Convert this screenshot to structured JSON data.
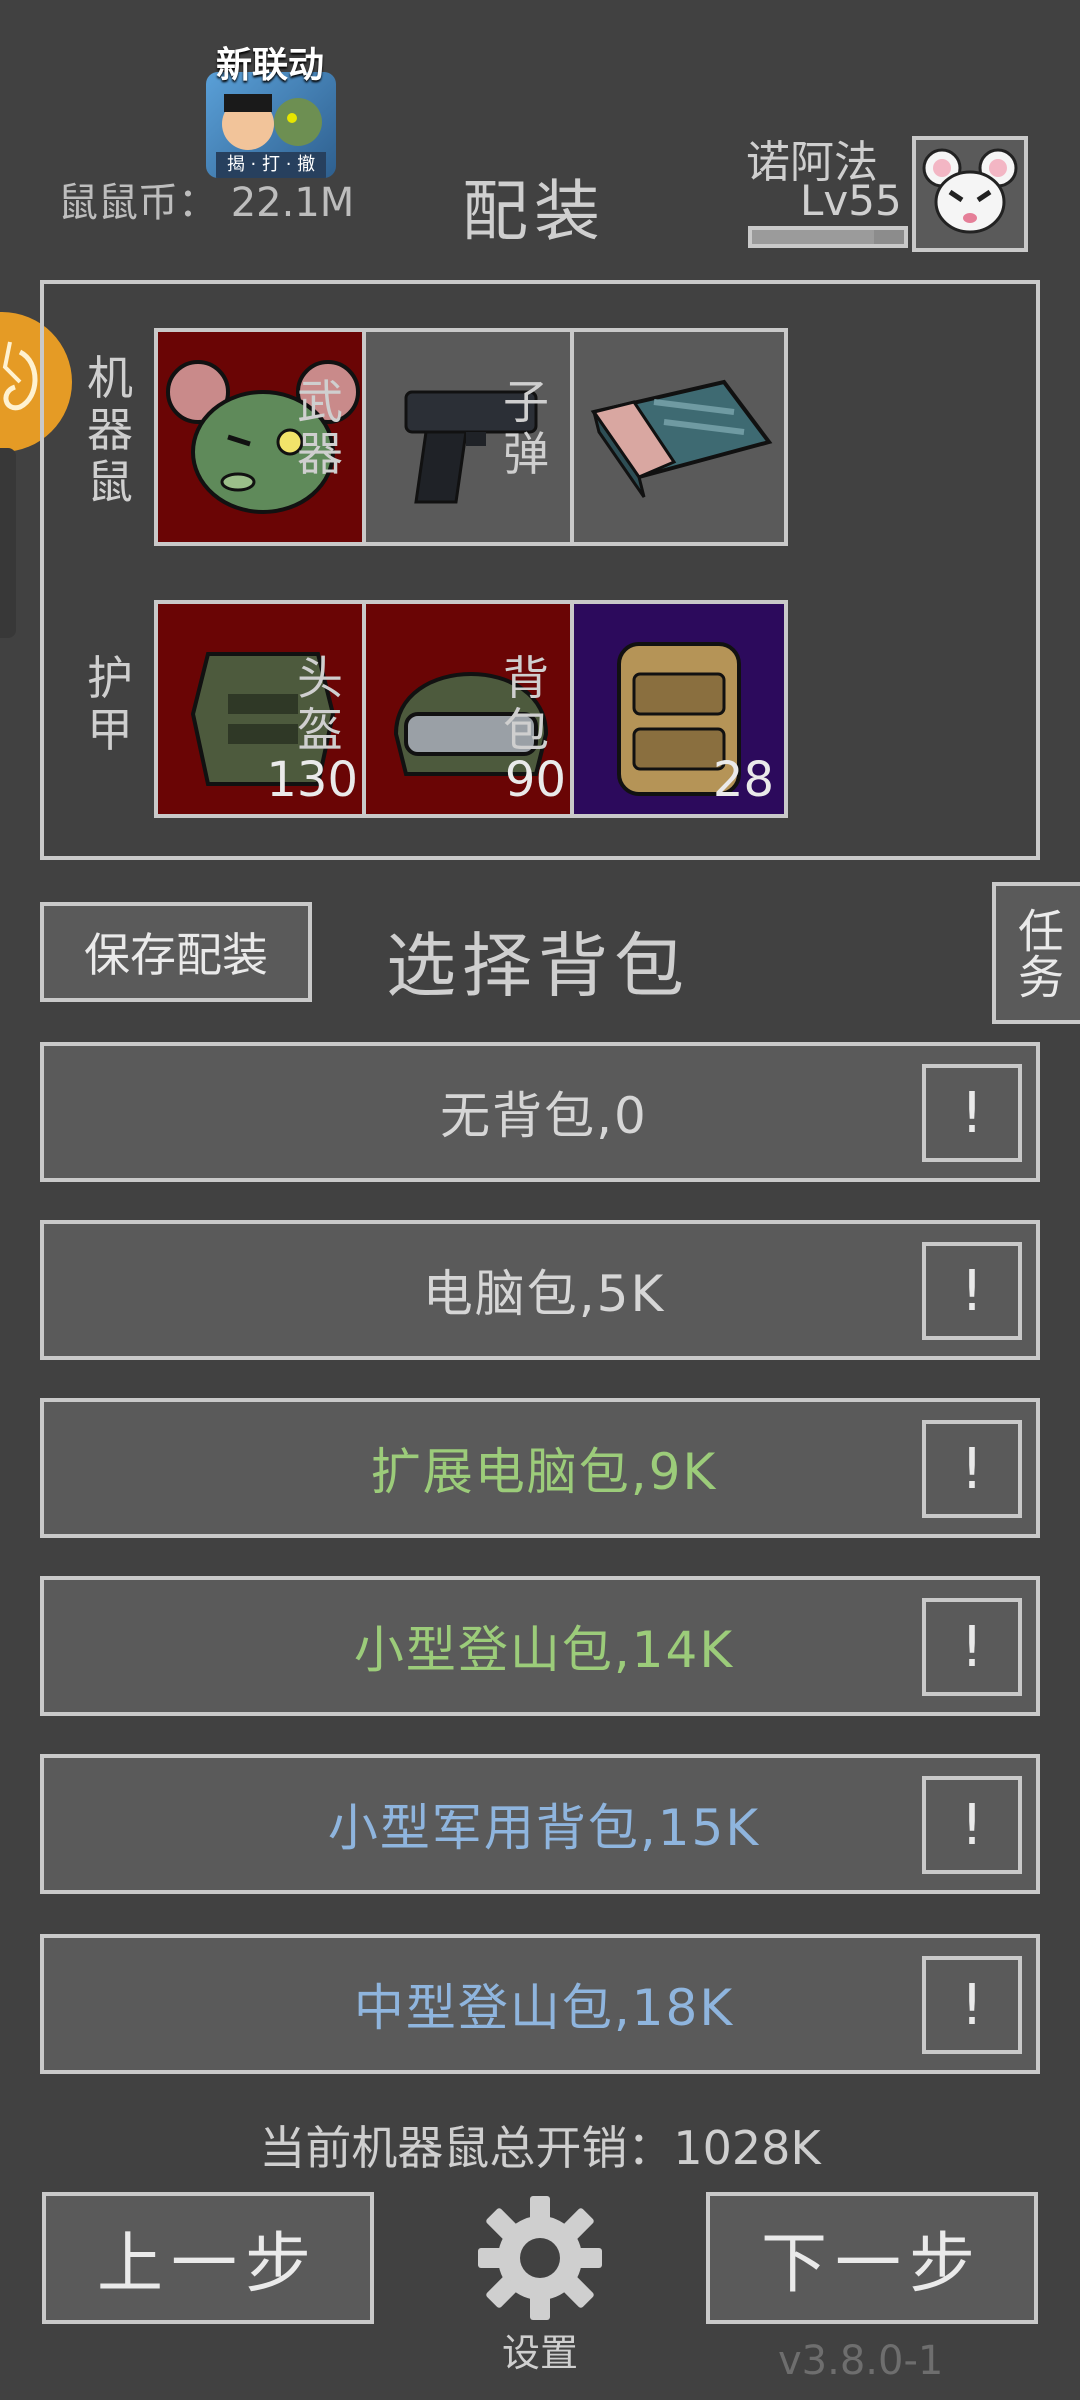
{
  "header": {
    "event_title": "新联动",
    "event_chips": [
      "揭",
      "打",
      "撤"
    ],
    "coins_label": "鼠鼠币：",
    "coins_value": "22.1M",
    "page_title": "配装",
    "player_name": "诺阿法",
    "player_level": "Lv55",
    "xp_progress": 0.8
  },
  "loadout": {
    "slots": [
      {
        "label": "机器鼠",
        "icon": "zombie-rat-icon"
      },
      {
        "label": "武器",
        "icon": "pistol-icon"
      },
      {
        "label": "子弹",
        "icon": "ammo-box-icon"
      },
      {
        "label": "护甲",
        "icon": "body-armor-icon",
        "value": "130"
      },
      {
        "label": "头盔",
        "icon": "helmet-icon",
        "value": "90"
      },
      {
        "label": "背包",
        "icon": "backpack-icon",
        "value": "28"
      }
    ]
  },
  "actions": {
    "save_label": "保存配装",
    "select_title": "选择背包",
    "task_label": "任务"
  },
  "options": [
    {
      "label": "无背包,0",
      "color": "#d6d6d6"
    },
    {
      "label": "电脑包,5K",
      "color": "#d6d6d6"
    },
    {
      "label": "扩展电脑包,9K",
      "color": "#9ccc7a"
    },
    {
      "label": "小型登山包,14K",
      "color": "#9ccc7a"
    },
    {
      "label": "小型军用背包,15K",
      "color": "#8fb5de"
    },
    {
      "label": "中型登山包,18K",
      "color": "#8fb5de"
    }
  ],
  "info_label": "!",
  "footer": {
    "total_cost": "当前机器鼠总开销：1028K",
    "prev_label": "上一步",
    "next_label": "下一步",
    "settings_label": "设置",
    "version": "v3.8.0-1"
  }
}
